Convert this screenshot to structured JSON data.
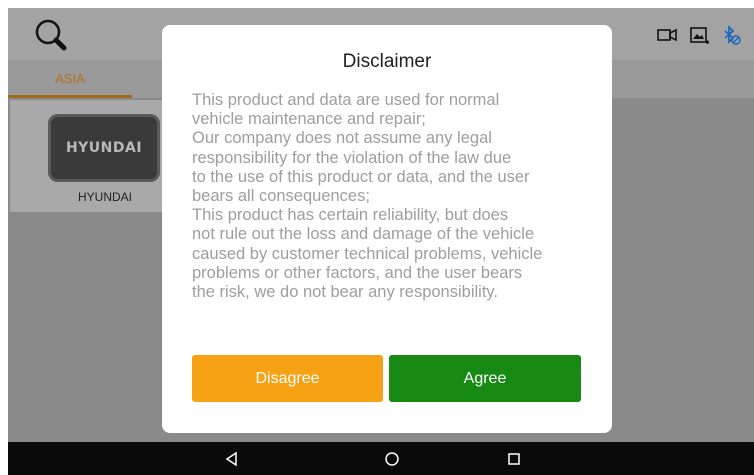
{
  "tabs": [
    {
      "label": "ASIA"
    }
  ],
  "brands": [
    {
      "logo_text": "HYUNDAI",
      "label": "HYUNDAI"
    }
  ],
  "icons": {
    "search": "search-icon",
    "video": "video-camera-icon",
    "image": "image-icon",
    "bluetooth": "bluetooth-icon"
  },
  "dialog": {
    "title": "Disclaimer",
    "body": "This product and data are used for normal\nvehicle maintenance and repair;\n Our company does not assume any legal\nresponsibility for the violation of the law due\nto the use of this product or data, and the user\nbears all consequences;\n This product has certain reliability, but does\nnot rule out the loss and damage of the vehicle\ncaused by customer technical problems, vehicle\nproblems or other factors, and the user bears\nthe risk, we do not bear any responsibility.",
    "disagree_label": "Disagree",
    "agree_label": "Agree"
  },
  "navbar": {
    "back": "back-triangle-icon",
    "home": "home-circle-icon",
    "recents": "recents-square-icon"
  },
  "colors": {
    "disagree": "#f6a214",
    "agree": "#168a12",
    "tab_active": "#b3721a",
    "navbar": "#0a0a0a"
  }
}
